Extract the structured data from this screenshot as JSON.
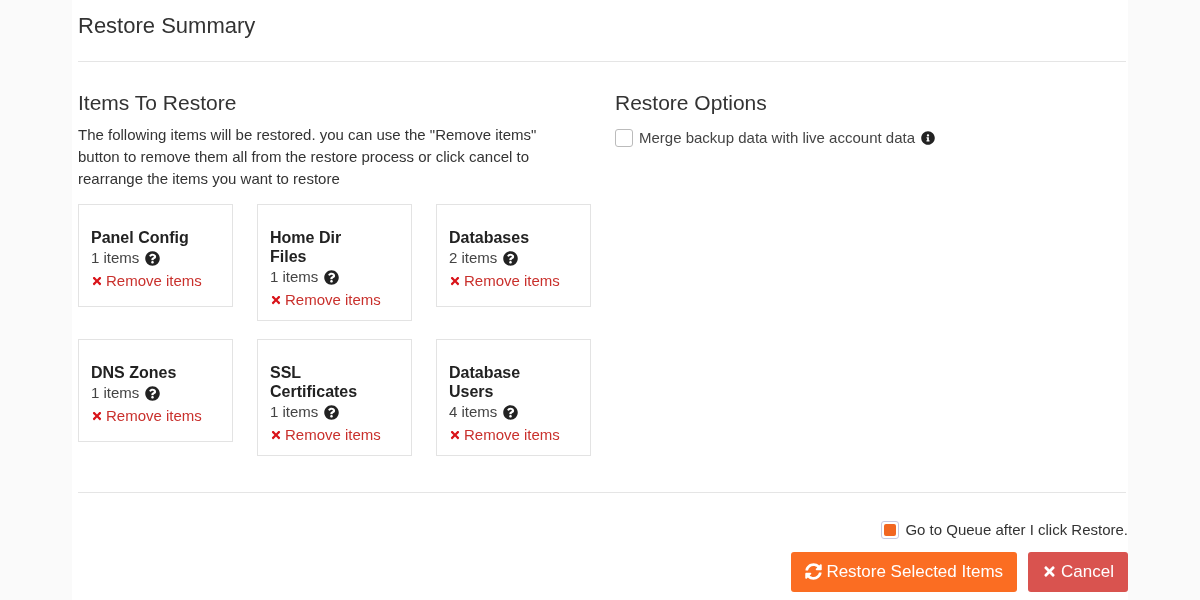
{
  "title": "Restore Summary",
  "items_section": {
    "heading": "Items To Restore",
    "description": "The following items will be restored. you can use the \"Remove items\" button to remove them all from the restore process or click cancel to rearrange the items you want to restore",
    "cards": [
      {
        "name": "Panel Config",
        "count": "1 items",
        "remove": "Remove items"
      },
      {
        "name": "Home Dir Files",
        "count": "1 items",
        "remove": "Remove items"
      },
      {
        "name": "Databases",
        "count": "2 items",
        "remove": "Remove items"
      },
      {
        "name": "DNS Zones",
        "count": "1 items",
        "remove": "Remove items"
      },
      {
        "name": "SSL Certificates",
        "count": "1 items",
        "remove": "Remove items"
      },
      {
        "name": "Database Users",
        "count": "4 items",
        "remove": "Remove items"
      }
    ]
  },
  "options_section": {
    "heading": "Restore Options",
    "options": [
      {
        "label": "Merge backup data with live account data",
        "checked": false
      }
    ]
  },
  "footer": {
    "queue_option": {
      "label": "Go to Queue after I click Restore.",
      "checked": true
    },
    "buttons": [
      {
        "label": "Restore Selected Items",
        "kind": "primary"
      },
      {
        "label": "Cancel",
        "kind": "cancel"
      }
    ]
  }
}
